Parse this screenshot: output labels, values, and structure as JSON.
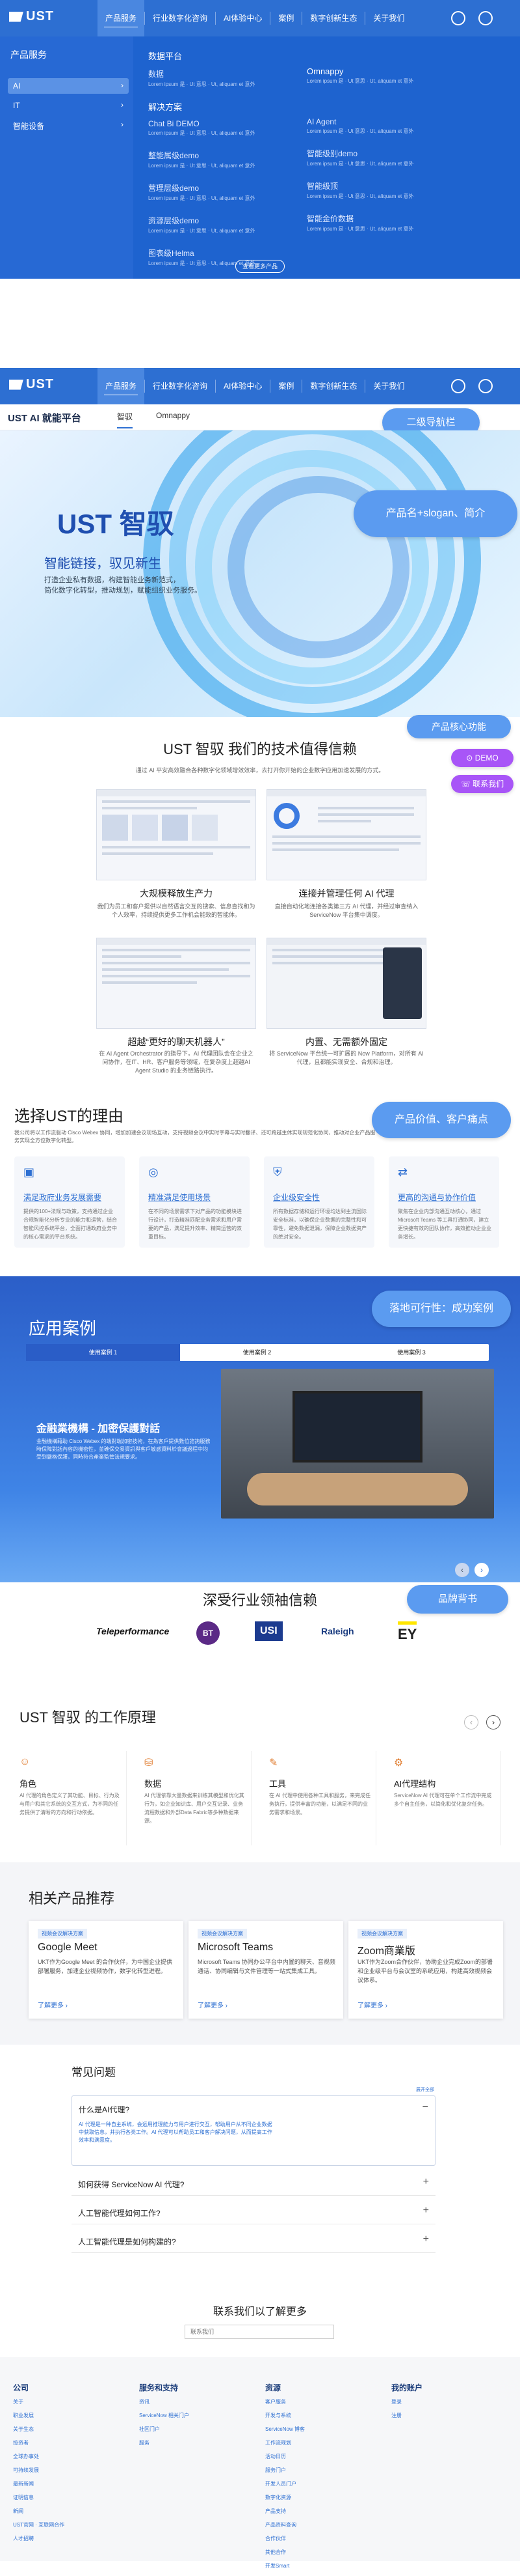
{
  "nav": {
    "logo": "UST",
    "items": [
      "产品服务",
      "行业数字化咨询",
      "AI体验中心",
      "案例",
      "数字创新生态",
      "关于我们"
    ]
  },
  "mega": {
    "left_title": "产品服务",
    "left_items": [
      "AI",
      "IT",
      "智能设备"
    ],
    "col1_head": "数据平台",
    "col1_items": [
      {
        "t": "数据",
        "s": "Lorem ipsum 是 · Ut 意思 · Ut, aliquam et 意外"
      }
    ],
    "col2_head": "Omnappy",
    "col2_items": [
      {
        "t": "",
        "s": "Lorem ipsum 是 · Ut 意思 · Ut, aliquam et 意外"
      }
    ],
    "sol_head": "解决方案",
    "sol_left": [
      {
        "t": "Chat Bi DEMO",
        "s": "Lorem ipsum 是 · Ut 意思 · Ut, aliquam et 意外"
      },
      {
        "t": "整能属级demo",
        "s": "Lorem ipsum 是 · Ut 意思 · Ut, aliquam et 意外"
      },
      {
        "t": "营理层级demo",
        "s": "Lorem ipsum 是 · Ut 意思 · Ut, aliquam et 意外"
      },
      {
        "t": "资源层级demo",
        "s": "Lorem ipsum 是 · Ut 意思 · Ut, aliquam et 意外"
      },
      {
        "t": "图表级Helma",
        "s": "Lorem ipsum 是 · Ut 意思 · Ut, aliquam et 意外"
      }
    ],
    "sol_right": [
      {
        "t": "AI Agent",
        "s": "Lorem ipsum 是 · Ut 意思 · Ut, aliquam et 意外"
      },
      {
        "t": "智能级别demo",
        "s": "Lorem ipsum 是 · Ut 意思 · Ut, aliquam et 意外"
      },
      {
        "t": "智能级顶",
        "s": "Lorem ipsum 是 · Ut 意思 · Ut, aliquam et 意外"
      },
      {
        "t": "智能金价数据",
        "s": "Lorem ipsum 是 · Ut 意思 · Ut, aliquam et 意外"
      }
    ],
    "more": "查看更多产品"
  },
  "subnav": {
    "title": "UST AI 就能平台",
    "tabs": [
      "智驭",
      "Omnappy"
    ]
  },
  "notes": {
    "nav2": "二级导航栏",
    "slogan": "产品名+slogan、简介",
    "core": "产品核心功能",
    "value": "产品价值、客户痛点",
    "feas": "落地可行性：成功案例",
    "brand": "品牌背书"
  },
  "side": {
    "demo": "DEMO",
    "contact": "联系我们"
  },
  "hero": {
    "title": "UST 智驭",
    "sub": "智能链接，驭见新生",
    "desc": "打造企业私有数据，构建智能业务新范式，\n简化数字化转型，推动规划，赋能组织业务服务。"
  },
  "tech": {
    "title": "UST 智驭 我们的技术值得信赖",
    "desc": "通过 AI 平安高效融合各种数字化领域增效效率，去打开你开始的企业数字应用加速发展的方式。",
    "items": [
      {
        "t": "大规模释放生产力",
        "d": "我们为员工和客户提供以自然语言交互的搜索、信息查找和为个人效率，持续提供更多工作机会能效的智能体。"
      },
      {
        "t": "连接并管理任何 AI 代理",
        "d": "直接自动化地连接各类第三方 AI 代理，并经过审查纳入 ServiceNow 平台集中调度。"
      },
      {
        "t": "超越“更好的聊天机器人”",
        "d": "在 AI Agent Orchestrator 的指导下，AI 代理团队会在企业之间协作，在IT、HR、客户服务等领域，在复杂度上超越AI Agent Studio 的业务链路执行。"
      },
      {
        "t": "内置、无需额外固定",
        "d": "将 ServiceNow 平台统一可扩展的 Now Platform，对所有 AI 代理，且都能实现安全、合规和治理。"
      }
    ]
  },
  "why": {
    "title": "选择UST的理由",
    "desc": "我公司将以工作流驱动 Cisco Webex 协同，增加加速会议现场互动，支持视频会议中实时字幕与实时翻译、还可跨越主体实现规范化协同，推动对企业产品服务实现全方位数字化转型。",
    "items": [
      {
        "t": "满足政府业务发展需要",
        "d": "提供的100+法规与政策，支持通过企业合规智能化分析专业的能力和运营，结合智能风控系统平台，全面打通政府业务中的核心需求的平台系统。"
      },
      {
        "t": "精准满足使用场景",
        "d": "在不同的场景需求下对产品的功能模块进行设计，打造精准匹配业务需求和用户需要的产品，满足提升效率、精简运营的双重目标。"
      },
      {
        "t": "企业级安全性",
        "d": "所有数据存储和运行环境均达到主流国际安全标准，以确保企业数据的完整性和可靠性，避免数据泄漏，保障企业数据资产的绝对安全。"
      },
      {
        "t": "更高的沟通与协作价值",
        "d": "聚焦在企业内部沟通互动核心，通过 Microsoft Teams 等工具打通协同，建立更快捷有效的团队协作，高效推动企业业务增长。"
      }
    ]
  },
  "cases": {
    "title": "应用案例",
    "tabs": [
      "使用案例 1",
      "使用案例 2",
      "使用案例 3"
    ],
    "ctitle": "金融業機構 - 加密保護對話",
    "cdesc": "金融機構藉助 Cisco Webex 的端對端加密技術，在為客戶提供數位諮詢服務時保障對話內容的機密性，並確保交易資訊與客戶敏感資料於會議過程中均受到嚴格保護，同時符合產業監管法規要求。"
  },
  "trust": {
    "title": "深受行业领袖信赖",
    "logos": [
      "Teleperformance",
      "BT",
      "USI",
      "Raleigh",
      "EY"
    ]
  },
  "how": {
    "title": "UST 智驭 的工作原理",
    "items": [
      {
        "t": "角色",
        "d": "AI 代理的角色定义了其功能、目标、行为及与用户和其它系统的交互方式，为不同的任务提供了清晰的方向和行动依据。"
      },
      {
        "t": "数据",
        "d": "AI 代理依靠大量数据来训练其模型和优化其行为，如企业知识库、用户交互记录、业务流程数据和外部Data Fabric等多种数据来源。"
      },
      {
        "t": "工具",
        "d": "在 AI 代理中使用各种工具和服务，来完成任务执行，提供丰富的功能，以满足不同的业务需求和场景。"
      },
      {
        "t": "AI代理结构",
        "d": "ServiceNow AI 代理可在单个工作流中完成多个自主任务，以简化和优化复杂任务。"
      }
    ]
  },
  "related": {
    "title": "相关产品推荐",
    "items": [
      {
        "tag": "视频会议解决方案",
        "t": "Google Meet",
        "d": "UKT作为Google Meet 的合作伙伴，为中国企业提供部署服务，加速企业视频协作，数字化转型进程。",
        "m": "了解更多"
      },
      {
        "tag": "视频会议解决方案",
        "t": "Microsoft Teams",
        "d": "Microsoft Teams 协同办公平台中内置的聊天、音视频通话、协同编辑与文件管理等一站式集成工具。",
        "m": "了解更多"
      },
      {
        "tag": "视频会议解决方案",
        "t": "Zoom商業版",
        "d": "UKT作为Zoom合作伙伴，协助企业完成Zoom的部署和企业级平台与会议室的系统应用，构建高效视频会议体系。",
        "m": "了解更多"
      }
    ]
  },
  "faq": {
    "title": "常见问题",
    "open_q": "什么是AI代理?",
    "open_a": "AI 代理是一种自主系统，会运用推理能力与用户进行交互，帮助用户从不同企业数据中获取信息，并执行各类工作。AI 代理可以帮助员工和客户解决问题，从而提高工作效率和满意度。",
    "toggle": "展开全部",
    "qs": [
      "如何获得 ServiceNow AI 代理?",
      "人工智能代理如何工作?",
      "人工智能代理是如何构建的?"
    ]
  },
  "contact": {
    "title": "联系我们以了解更多",
    "placeholder": "联系我们"
  },
  "footer": [
    {
      "h": "公司",
      "l": [
        "关于",
        "职业发展",
        "关于生态",
        "投资者",
        "全球办事处",
        "可持续发展",
        "最新新闻",
        "证明信息",
        "新闻",
        "UST官网 · 互联网合作",
        "人才招聘"
      ]
    },
    {
      "h": "服务和支持",
      "l": [
        "资讯",
        "ServiceNow 相关门户",
        "社区门户",
        "服务"
      ]
    },
    {
      "h": "资源",
      "l": [
        "客户服务",
        "开发与系统",
        "ServiceNow 博客",
        "工作流规划",
        "活动日历",
        "服务门户",
        "开发人员门户",
        "数字化资源",
        "产品支持",
        "产品资料查询",
        "合作伙伴",
        "其他合作",
        "开发Smart"
      ]
    },
    {
      "h": "我的账户",
      "l": [
        "登录",
        "注册"
      ]
    }
  ]
}
